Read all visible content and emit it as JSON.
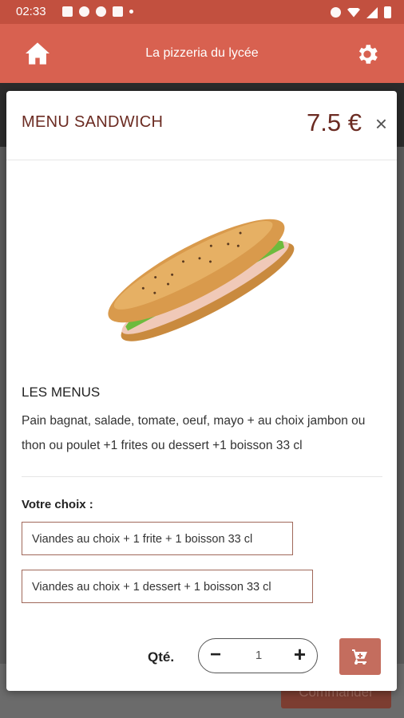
{
  "status_bar": {
    "time": "02:33"
  },
  "app_bar": {
    "title": "La pizzeria du lycée"
  },
  "backdrop": {
    "order_button_label": "Commander"
  },
  "modal": {
    "title": "MENU SANDWICH",
    "price": "7.5 €",
    "close_symbol": "×",
    "section_title": "LES MENUS",
    "description": "Pain bagnat, salade, tomate, oeuf, mayo + au choix jambon ou thon ou poulet +1 frites ou dessert +1 boisson 33 cl",
    "choice_label": "Votre choix :",
    "choices": [
      {
        "label": "Viandes au choix + 1 frite + 1 boisson 33 cl"
      },
      {
        "label": "Viandes au choix + 1 dessert + 1 boisson 33 cl"
      }
    ],
    "quantity_label": "Qté.",
    "quantity_value": "1",
    "minus_symbol": "−",
    "plus_symbol": "+"
  },
  "icons": {
    "home": "home-icon",
    "settings": "gear-icon",
    "cart": "cart-icon"
  },
  "colors": {
    "app_bar": "#d86150",
    "status_bar": "#c2503f",
    "accent_text": "#6b2b22",
    "cart_button": "#c46d5e",
    "choice_border": "#a0685a"
  }
}
